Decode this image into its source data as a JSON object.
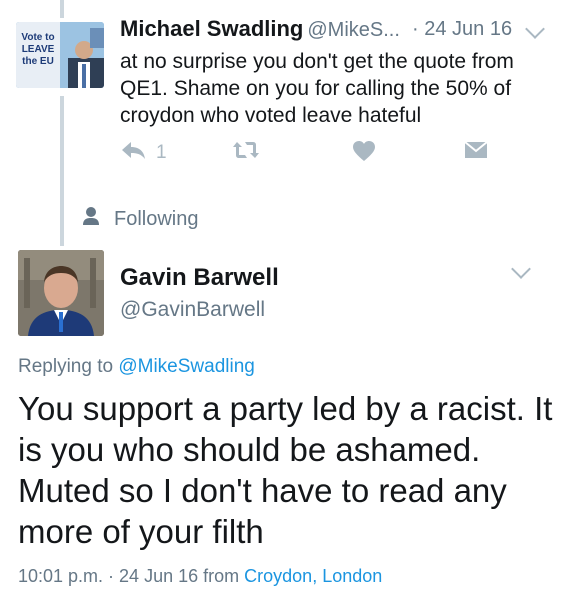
{
  "tweet1": {
    "author_name": "Michael Swadling",
    "author_handle": "@MikeS...",
    "date": "· 24 Jun 16",
    "avatar_sign_lines": [
      "Vote to",
      "LEAVE",
      "the EU"
    ],
    "text": "at no surprise you don't get the quote from QE1.  Shame on you for calling the 50% of croydon who voted leave hateful",
    "reply_count": "1"
  },
  "follow": {
    "label": "Following"
  },
  "tweet2": {
    "author_name": "Gavin Barwell",
    "author_handle": "@GavinBarwell",
    "replying_prefix": "Replying to",
    "replying_handle": "@MikeSwadling",
    "text": "You support a party led by a racist. It is you who should be ashamed. Muted so I don't have to read any more of your filth",
    "time": "10:01 p.m. · 24 Jun 16",
    "from_prefix": "from",
    "location": "Croydon, London"
  },
  "colors": {
    "link": "#1b95e0",
    "muted": "#657786",
    "icon": "#aab8c2",
    "thread_line": "#ccd6dd"
  },
  "icons": [
    "reply-icon",
    "retweet-icon",
    "like-icon",
    "dm-icon",
    "person-icon",
    "chevron-down-icon"
  ]
}
